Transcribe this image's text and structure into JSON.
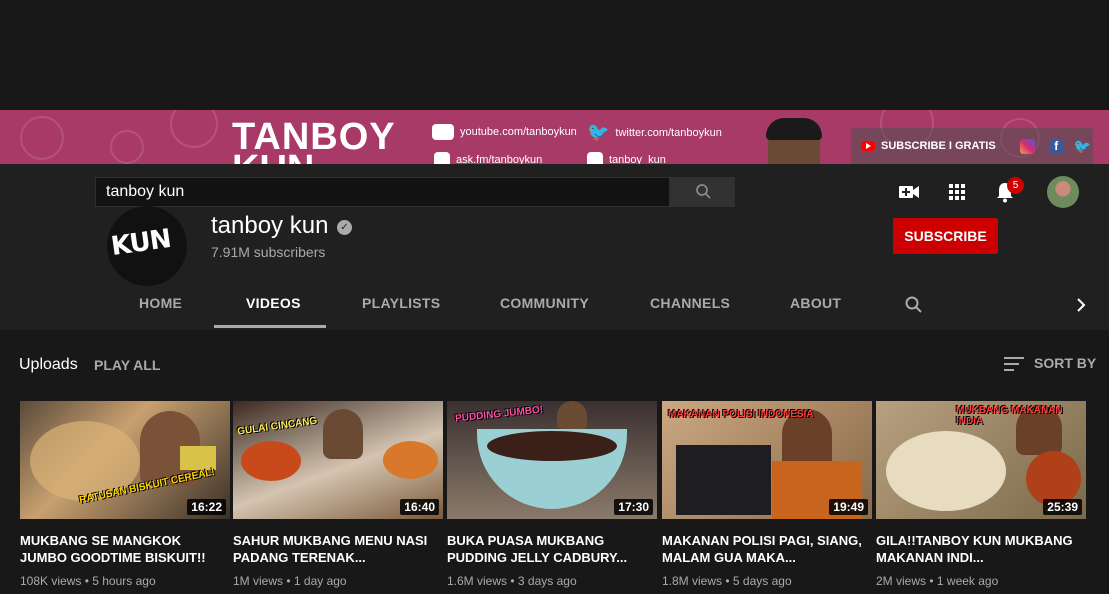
{
  "banner": {
    "title_line1": "TANBOY",
    "title_line2": "KUN",
    "links": [
      "youtube.com/tanboykun",
      "twitter.com/tanboykun",
      "ask.fm/tanboykun",
      "tanboy_kun"
    ],
    "subscribe_label": "SUBSCRIBE I GRATIS"
  },
  "topbar": {
    "search_value": "tanboy kun",
    "notification_count": "5"
  },
  "channel": {
    "avatar_text": "KUN",
    "name": "tanboy kun",
    "subscribers": "7.91M subscribers",
    "subscribe_label": "SUBSCRIBE"
  },
  "tabs": [
    "HOME",
    "VIDEOS",
    "PLAYLISTS",
    "COMMUNITY",
    "CHANNELS",
    "ABOUT"
  ],
  "active_tab": "VIDEOS",
  "section": {
    "title": "Uploads",
    "play_all": "PLAY ALL",
    "sort_by": "SORT BY"
  },
  "videos": [
    {
      "title": "MUKBANG SE MANGKOK JUMBO GOODTIME BISKUIT!!",
      "views": "108K views",
      "age": "5 hours ago",
      "duration": "16:22",
      "thumb_text": "RATUSAN BISKUIT CEREAL!",
      "thumb_color": "#8a6a4a"
    },
    {
      "title": "SAHUR MUKBANG MENU NASI PADANG TERENAK...",
      "views": "1M views",
      "age": "1 day ago",
      "duration": "16:40",
      "thumb_text": "GULAI CINCANG",
      "thumb_color": "#b65a2a"
    },
    {
      "title": "BUKA PUASA MUKBANG PUDDING JELLY CADBURY...",
      "views": "1.6M views",
      "age": "3 days ago",
      "duration": "17:30",
      "thumb_text": "PUDDING JUMBO!",
      "thumb_color": "#4a3a3a"
    },
    {
      "title": "MAKANAN POLISI PAGI, SIANG, MALAM GUA MAKA...",
      "views": "1.8M views",
      "age": "5 days ago",
      "duration": "19:49",
      "thumb_text": "MAKANAN POLISI INDONESIA",
      "thumb_color": "#9a7a5a"
    },
    {
      "title": "GILA!!TANBOY KUN MUKBANG MAKANAN INDI...",
      "views": "2M views",
      "age": "1 week ago",
      "duration": "25:39",
      "thumb_text": "MUKBANG MAKANAN INDIA",
      "thumb_color": "#a89070"
    }
  ],
  "colors": {
    "accent": "#cc0000",
    "banner": "#a83a68",
    "background": "#181818"
  }
}
